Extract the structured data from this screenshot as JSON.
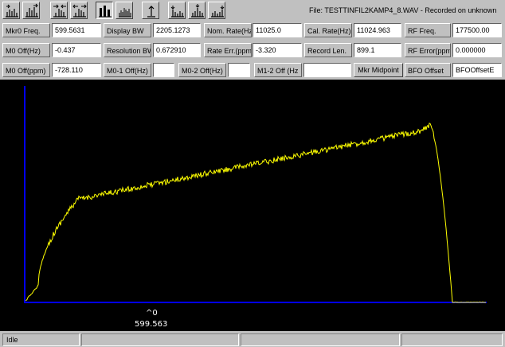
{
  "window": {
    "file_title": "File: TESTTINFIL2KAMP4_8.WAV - Recorded on  unknown"
  },
  "toolbar": {
    "buttons": [
      {
        "icon": "scale-compress-icon",
        "pressed": false
      },
      {
        "icon": "scale-expand-icon",
        "pressed": false
      },
      {
        "icon": "zoom-in-icon",
        "pressed": false
      },
      {
        "icon": "zoom-out-icon",
        "pressed": false
      },
      {
        "icon": "bar-spectrum-icon",
        "pressed": true
      },
      {
        "icon": "line-spectrum-icon",
        "pressed": false
      },
      {
        "icon": "marker-icon",
        "pressed": false
      },
      {
        "icon": "marker-left-icon",
        "pressed": false
      },
      {
        "icon": "marker-center-icon",
        "pressed": false
      },
      {
        "icon": "marker-right-icon",
        "pressed": false
      }
    ]
  },
  "fields": {
    "row1": {
      "mkr0_freq_label": "Mkr0 Freq.",
      "mkr0_freq_value": "599.5631",
      "display_bw_label": "Display BW",
      "display_bw_value": "2205.1273",
      "nom_rate_label": "Nom. Rate(Hz",
      "nom_rate_value": "11025.0",
      "cal_rate_label": "Cal. Rate(Hz)",
      "cal_rate_value": "11024.963",
      "rf_freq_label": "RF Freq.",
      "rf_freq_value": "177500.00"
    },
    "row2": {
      "m0_off_hz_label": "M0 Off(Hz)",
      "m0_off_hz_value": "-0.437",
      "resolution_bw_label": "Resolution BW",
      "resolution_bw_value": "0.672910",
      "rate_err_label": "Rate Err.(ppm",
      "rate_err_value": "-3.320",
      "record_len_label": "Record Len.",
      "record_len_value": "899.1",
      "rf_error_label": "RF Error(ppm",
      "rf_error_value": "0.000000"
    },
    "row3": {
      "m0_off_ppm_label": "M0 Off(ppm)",
      "m0_off_ppm_value": "-728.110",
      "m01_off_label": "M0-1 Off(Hz)",
      "m01_off_value": "",
      "m02_off_label": "M0-2 Off(Hz)",
      "m02_off_value": "",
      "m12_off_label": "M1-2 Off (Hz",
      "m12_off_value": "",
      "mkr_midpoint_label": "Mkr Midpoint",
      "bfo_offset_label": "BFO Offset",
      "bfo_offset_value": "BFOOffsetE"
    }
  },
  "plot": {
    "marker_label": "^0",
    "marker_freq": "599.563",
    "colors": {
      "background": "#000000",
      "trace": "#ffff00",
      "axis": "#0000ff"
    }
  },
  "status": {
    "text": "Idle"
  }
}
